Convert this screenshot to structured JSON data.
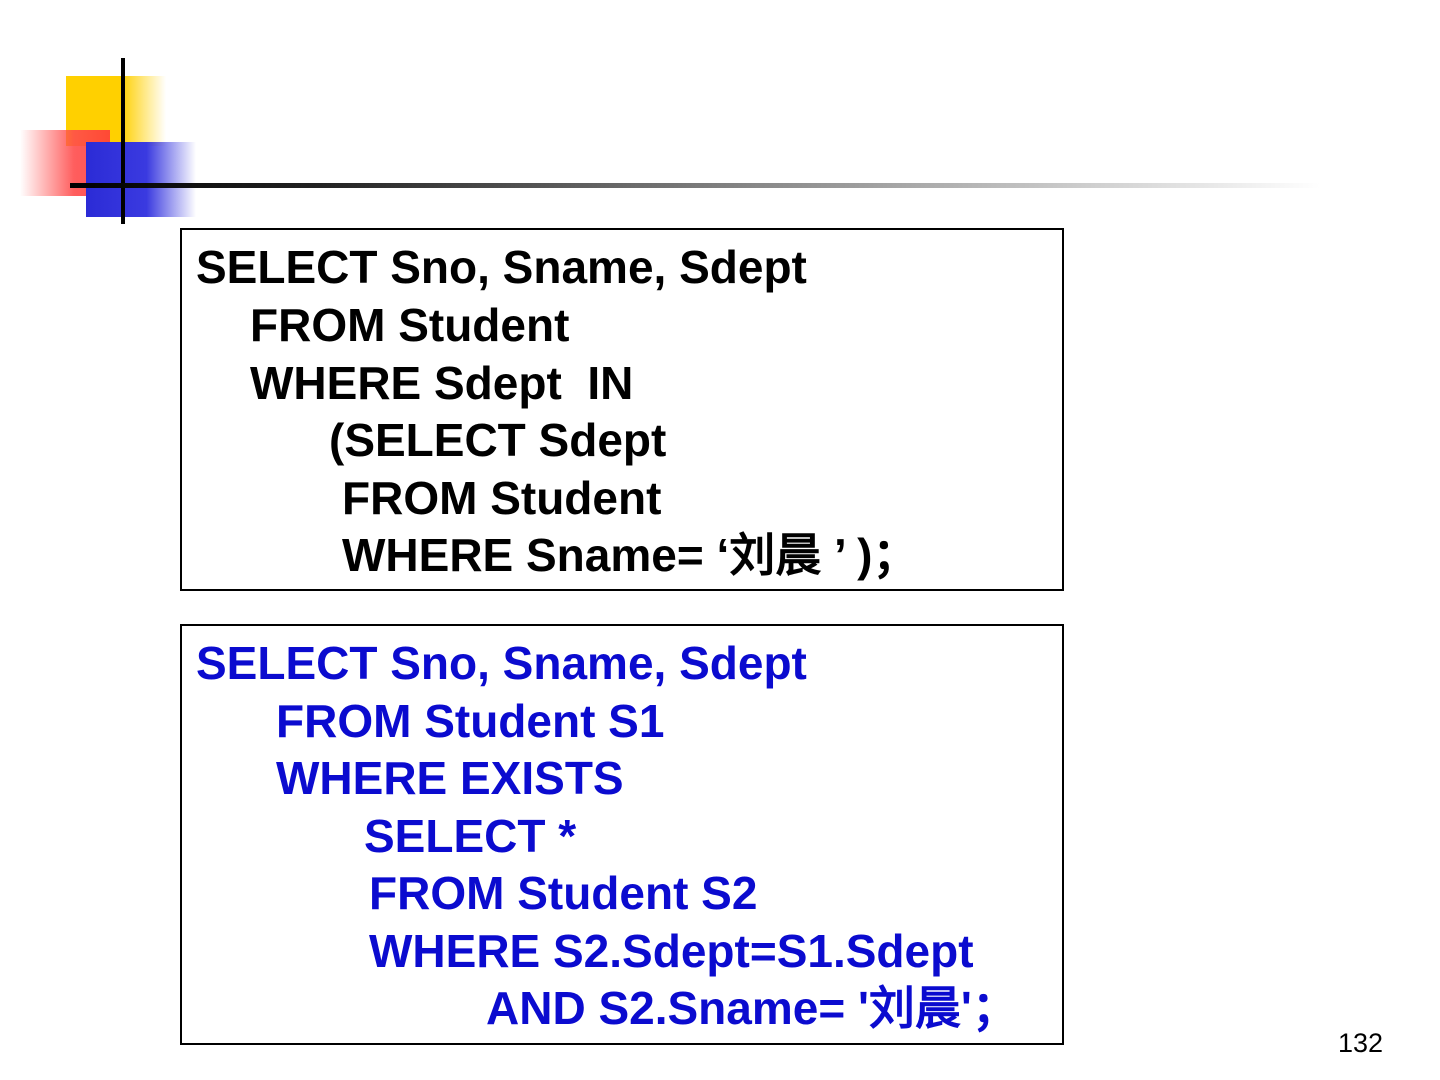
{
  "query_without_exists": {
    "lines": [
      "SELECT Sno, Sname, Sdept",
      "FROM Student",
      "WHERE Sdept  IN",
      "(SELECT Sdept",
      "FROM Student",
      "WHERE Sname= ‘刘晨 ’ )；"
    ]
  },
  "query_with_exists": {
    "lines": [
      "SELECT Sno, Sname, Sdept",
      "FROM Student S1",
      "WHERE EXISTS",
      "SELECT *",
      "FROM Student S2",
      "WHERE S2.Sdept=S1.Sdept",
      "AND S2.Sname= '刘晨'；"
    ],
    "color": "#0b0bcf"
  },
  "page_number": "132",
  "colors": {
    "accent_yellow": "#ffd000",
    "accent_red": "#ff4c4c",
    "accent_blue": "#2b2bd6"
  }
}
